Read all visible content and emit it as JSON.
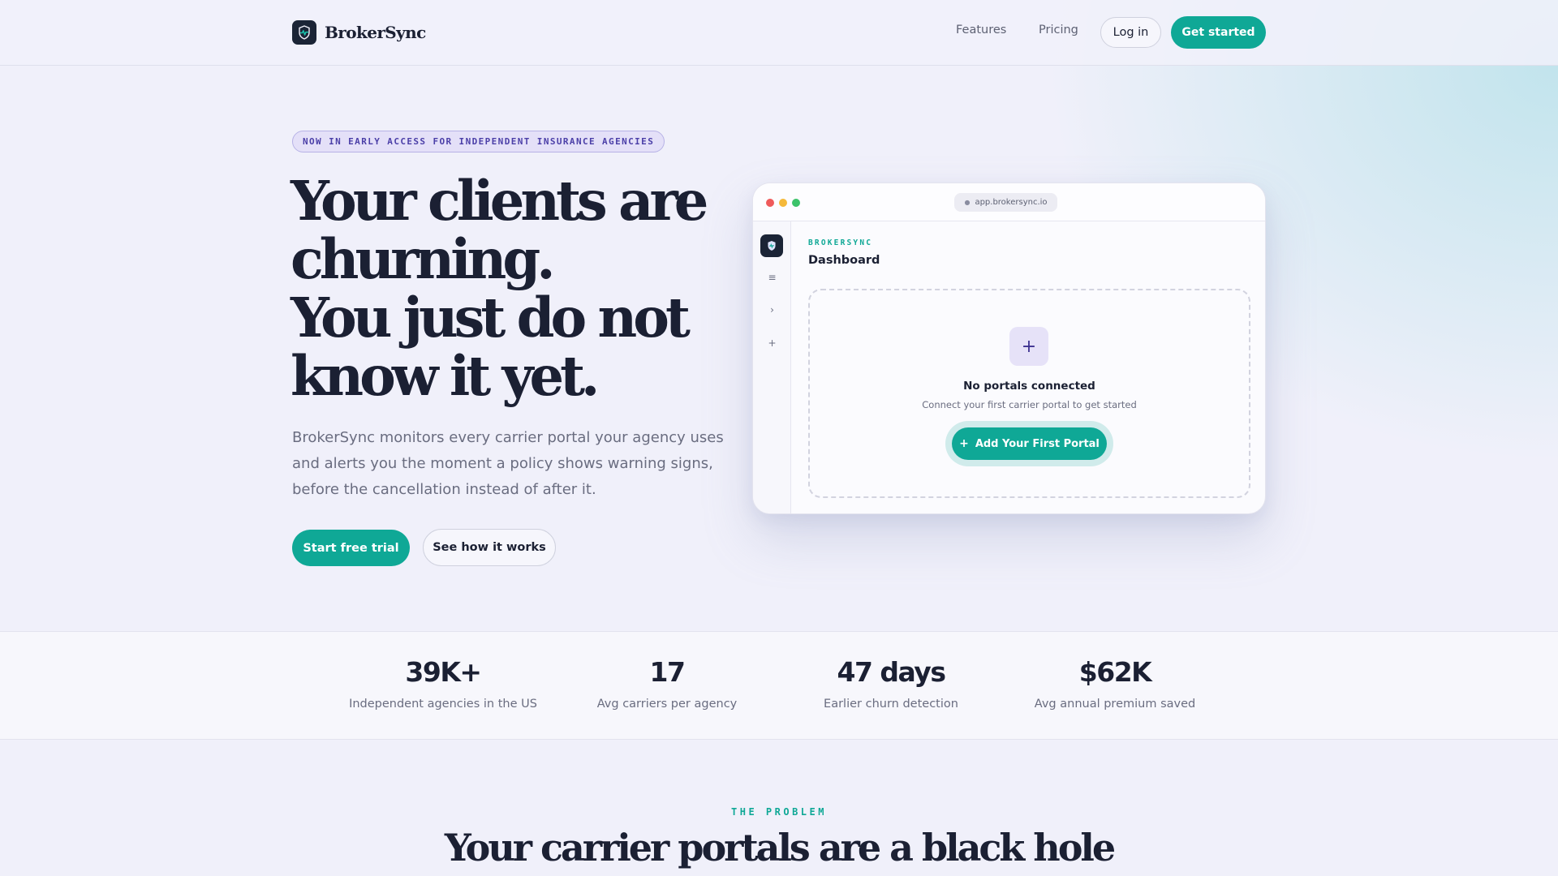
{
  "brand": {
    "name": "BrokerSync",
    "icon": "pulse-shield-icon",
    "accent": "#0fa896",
    "dark": "#1b2436"
  },
  "nav": {
    "features": "Features",
    "pricing": "Pricing",
    "login": "Log in",
    "get_started": "Get started"
  },
  "hero": {
    "badge": "NOW IN EARLY ACCESS FOR INDEPENDENT INSURANCE AGENCIES",
    "headline_lines": [
      "Your clients are",
      "churning.",
      "You just do not",
      "know it yet."
    ],
    "lede": "BrokerSync monitors every carrier portal your agency uses and alerts you the moment a policy shows warning signs, before the cancellation instead of after it.",
    "primary_cta": "Start free trial",
    "secondary_cta": "See how it works"
  },
  "preview": {
    "url": "app.brokersync.io",
    "eyebrow": "BROKERSYNC",
    "title": "Dashboard",
    "sidebar_icons": [
      "shield-icon",
      "menu-icon",
      "chevron-right-icon",
      "plus-icon"
    ],
    "empty_title": "No portals connected",
    "empty_sub": "Connect your first carrier portal to get started",
    "add_button": "Add Your First Portal"
  },
  "stats": [
    {
      "value": "39K+",
      "label": "Independent agencies in the US"
    },
    {
      "value": "17",
      "label": "Avg carriers per agency"
    },
    {
      "value": "47 days",
      "label": "Earlier churn detection"
    },
    {
      "value": "$62K",
      "label": "Avg annual premium saved"
    }
  ],
  "problem": {
    "eyebrow": "THE PROBLEM",
    "heading": "Your carrier portals are a black hole"
  }
}
